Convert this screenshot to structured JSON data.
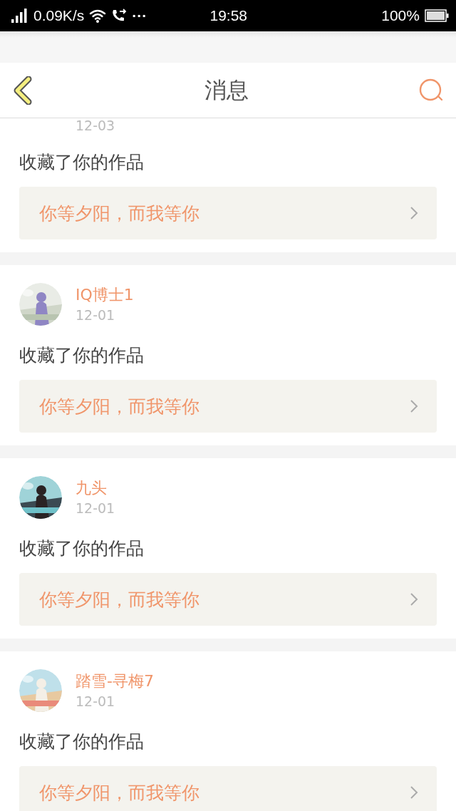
{
  "status_bar": {
    "network_speed": "0.09K/s",
    "more": "···",
    "time": "19:58",
    "battery": "100%"
  },
  "nav": {
    "title": "消息"
  },
  "messages": [
    {
      "date": "12-03",
      "action": "收藏了你的作品",
      "work": "你等夕阳，而我等你"
    },
    {
      "name": "IQ博士1",
      "date": "12-01",
      "action": "收藏了你的作品",
      "work": "你等夕阳，而我等你"
    },
    {
      "name": "九头",
      "date": "12-01",
      "action": "收藏了你的作品",
      "work": "你等夕阳，而我等你"
    },
    {
      "name": "踏雪-寻梅7",
      "date": "12-01",
      "action": "收藏了你的作品",
      "work": "你等夕阳，而我等你"
    }
  ]
}
